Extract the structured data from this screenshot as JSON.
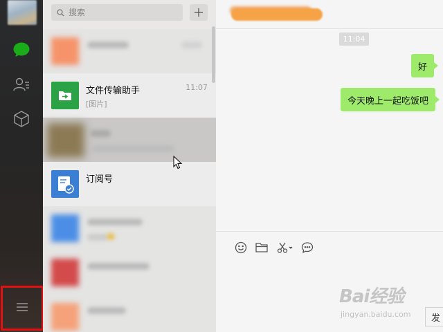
{
  "search": {
    "placeholder": "搜索"
  },
  "conversations": [
    {
      "title": "",
      "subtitle": "",
      "time": ""
    },
    {
      "title": "文件传输助手",
      "subtitle": "[图片]",
      "time": "11:07"
    },
    {
      "title": "",
      "subtitle": "",
      "time": ""
    },
    {
      "title": "订阅号",
      "subtitle": "",
      "time": ""
    },
    {
      "title": "",
      "subtitle": "",
      "time": ""
    },
    {
      "title": "",
      "subtitle": "",
      "time": ""
    },
    {
      "title": "",
      "subtitle": "",
      "time": ""
    }
  ],
  "chat": {
    "time_divider": "11:04",
    "messages": [
      {
        "text": "好",
        "from": "me"
      },
      {
        "text": "今天晚上一起吃饭吧",
        "from": "me"
      }
    ],
    "send_label": "发"
  },
  "watermark": {
    "line1": "Bai经验",
    "line2": "jingyan.baidu.com"
  },
  "icons": {
    "sidebar": [
      "chat-bubble-icon",
      "contacts-icon",
      "cube-icon",
      "menu-icon"
    ],
    "toolbar": [
      "emoji-icon",
      "folder-icon",
      "scissors-icon",
      "speech-bubble-icon"
    ]
  },
  "colors": {
    "accent_green": "#1aad19",
    "bubble_green": "#9eea6a",
    "highlight_red": "#e01212"
  }
}
